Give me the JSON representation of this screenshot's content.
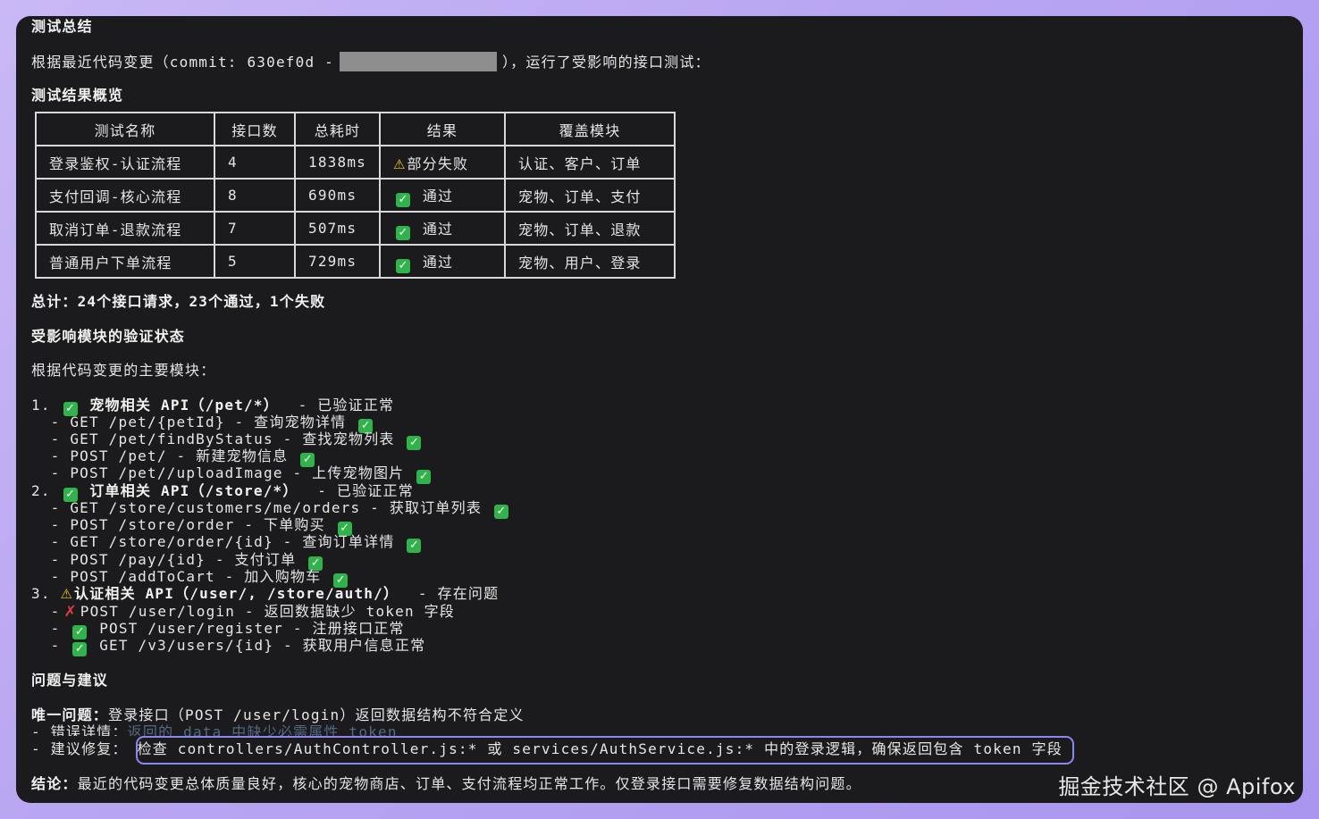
{
  "heading_summary": "测试总结",
  "intro": {
    "before": "根据最近代码变更（commit: 630ef0d -",
    "after": "），运行了受影响的接口测试："
  },
  "heading_overview": "测试结果概览",
  "table": {
    "headers": [
      "测试名称",
      "接口数",
      "总耗时",
      "结果",
      "覆盖模块"
    ],
    "rows": [
      {
        "name": "登录鉴权-认证流程",
        "count": "4",
        "time": "1838ms",
        "status": "warn",
        "result": "部分失败",
        "modules": "认证、客户、订单"
      },
      {
        "name": "支付回调-核心流程",
        "count": "8",
        "time": "690ms",
        "status": "ok",
        "result": "通过",
        "modules": "宠物、订单、支付"
      },
      {
        "name": "取消订单-退款流程",
        "count": "7",
        "time": "507ms",
        "status": "ok",
        "result": "通过",
        "modules": "宠物、订单、退款"
      },
      {
        "name": "普通用户下单流程",
        "count": "5",
        "time": "729ms",
        "status": "ok",
        "result": "通过",
        "modules": "宠物、用户、登录"
      }
    ]
  },
  "total": "总计：24个接口请求，23个通过，1个失败",
  "heading_modules": "受影响模块的验证状态",
  "modules_intro": "根据代码变更的主要模块：",
  "groups": [
    {
      "index": "1.",
      "status": "ok",
      "title": "宠物相关 API（/pet/*）",
      "note": "- 已验证正常",
      "items": [
        {
          "text": "GET /pet/{petId} - 查询宠物详情",
          "status": "ok"
        },
        {
          "text": "GET /pet/findByStatus - 查找宠物列表",
          "status": "ok"
        },
        {
          "text": "POST /pet/ - 新建宠物信息",
          "status": "ok"
        },
        {
          "text": "POST /pet//uploadImage - 上传宠物图片",
          "status": "ok"
        }
      ]
    },
    {
      "index": "2.",
      "status": "ok",
      "title": "订单相关 API（/store/*）",
      "note": "- 已验证正常",
      "items": [
        {
          "text": "GET /store/customers/me/orders - 获取订单列表",
          "status": "ok"
        },
        {
          "text": "POST /store/order - 下单购买",
          "status": "ok"
        },
        {
          "text": "GET /store/order/{id} - 查询订单详情",
          "status": "ok"
        },
        {
          "text": "POST /pay/{id} - 支付订单",
          "status": "ok"
        },
        {
          "text": "POST /addToCart - 加入购物车",
          "status": "ok"
        }
      ]
    },
    {
      "index": "3.",
      "status": "warn",
      "title": "认证相关 API（/user/, /store/auth/）",
      "note": "- 存在问题",
      "items": [
        {
          "text": "POST /user/login - 返回数据缺少 token 字段",
          "status": "fail"
        },
        {
          "text": "POST /user/register - 注册接口正常",
          "status": "ok"
        },
        {
          "text": "GET /v3/users/{id} - 获取用户信息正常",
          "status": "ok"
        }
      ]
    }
  ],
  "heading_issues": "问题与建议",
  "issue": {
    "label": "唯一问题：",
    "text": "登录接口（POST /user/login）返回数据结构不符合定义"
  },
  "error_detail": {
    "label": "- 错误详情：",
    "text": "返回的 data 中缺少必需属性 token"
  },
  "fix": {
    "label": "- 建议修复：",
    "text": "检查 controllers/AuthController.js:* 或 services/AuthService.js:* 中的登录逻辑，确保返回包含 token 字段"
  },
  "conclusion": {
    "label": "结论：",
    "text": "最近的代码变更总体质量良好，核心的宠物商店、订单、支付流程均正常工作。仅登录接口需要修复数据结构问题。"
  },
  "watermark": "掘金技术社区 @ Apifox",
  "colors": {
    "ok": "#2fb34a",
    "warn": "#f6c22a",
    "fail": "#e23b3b",
    "highlight": "#8d86f0",
    "terminal_bg": "#1b1b1d"
  }
}
